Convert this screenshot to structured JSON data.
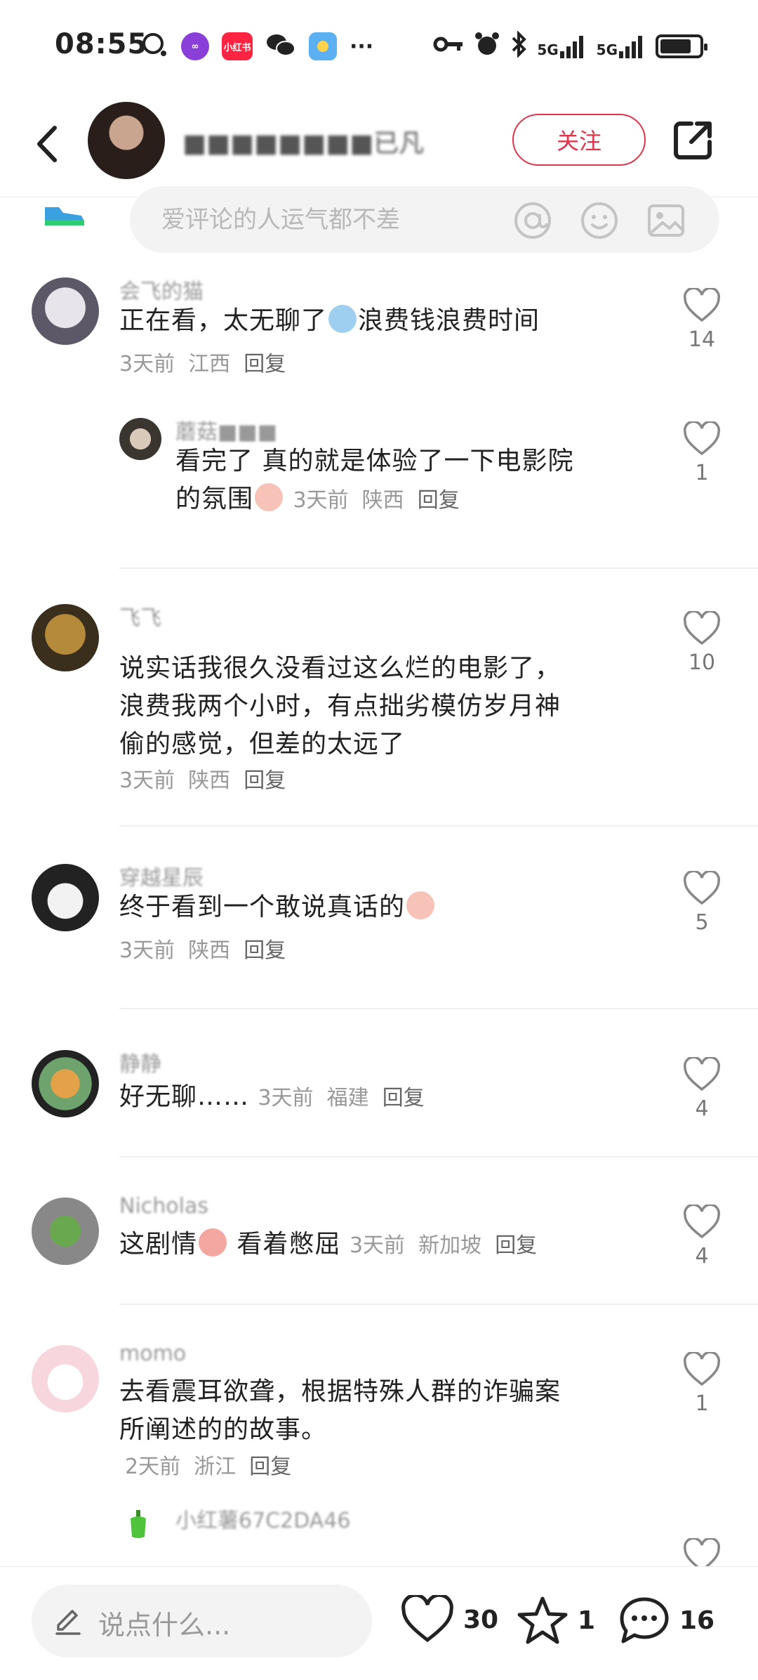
{
  "status_bar": {
    "time": "08:55",
    "app_badge": "小红书",
    "network_1": "5G",
    "network_2": "5G",
    "battery_level": 0.8
  },
  "header": {
    "author_name": "■■■■■■■■已凡",
    "follow_label": "关注"
  },
  "comment_input": {
    "placeholder": "爱评论的人运气都不差"
  },
  "comments": [
    {
      "name": "会飞的猫",
      "text": "正在看，太无聊了",
      "text_after": "浪费钱浪费时间",
      "time": "3天前",
      "location": "江西",
      "reply_label": "回复",
      "likes": "14",
      "sub": {
        "name": "蘑菇■■■",
        "text_line1": "看完了 真的就是体验了一下电影院",
        "text_line2": "的氛围",
        "time": "3天前",
        "location": "陕西",
        "reply_label": "回复",
        "likes": "1"
      }
    },
    {
      "name": "飞飞",
      "text_line1": "说实话我很久没看过这么烂的电影了，",
      "text_line2": "浪费我两个小时，有点拙劣模仿岁月神",
      "text_line3": "偷的感觉，但差的太远了",
      "time": "3天前",
      "location": "陕西",
      "reply_label": "回复",
      "likes": "10"
    },
    {
      "name": "穿越星辰",
      "text": "终于看到一个敢说真话的",
      "time": "3天前",
      "location": "陕西",
      "reply_label": "回复",
      "likes": "5"
    },
    {
      "name": "静静",
      "text": "好无聊……",
      "time": "3天前",
      "location": "福建",
      "reply_label": "回复",
      "likes": "4"
    },
    {
      "name": "Nicholas",
      "text": "这剧情",
      "text_after": "看着憋屈",
      "time": "3天前",
      "location": "新加坡",
      "reply_label": "回复",
      "likes": "4"
    },
    {
      "name": "momo",
      "text_line1": "去看震耳欲聋，根据特殊人群的诈骗案",
      "text_line2": "所阐述的的故事。",
      "time": "2天前",
      "location": "浙江",
      "reply_label": "回复",
      "likes": "1",
      "sub": {
        "name": "小红薯67C2DA46"
      }
    }
  ],
  "bottom_bar": {
    "input_placeholder": "说点什么...",
    "likes": "30",
    "stars": "1",
    "comments": "16"
  },
  "colors": {
    "accent": "#e0344d",
    "text_primary": "#222222",
    "text_secondary": "#999999"
  }
}
